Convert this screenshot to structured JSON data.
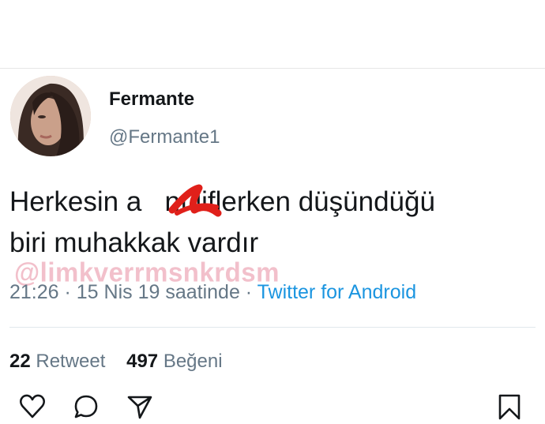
{
  "tweet": {
    "display_name": "Fermante",
    "handle": "@Fermante1",
    "text_line1": "Herkesin a   nı liflerken düşündüğü",
    "text_line2": "biri muhakkak vardır",
    "time": "21:26 · 15 Nis 19 saatinde",
    "separator": " · ",
    "source": "Twitter for Android",
    "watermark": "@limkverrmsnkrdsm"
  },
  "stats": {
    "retweets_count": "22",
    "retweets_label": "Retweet",
    "likes_count": "497",
    "likes_label": "Beğeni"
  },
  "actions": {
    "icons": [
      "heart-icon",
      "comment-icon",
      "share-icon",
      "bookmark-icon"
    ]
  },
  "colors": {
    "text": "#14171a",
    "secondary": "#657786",
    "link": "#1b95e0",
    "redact": "#e0201a",
    "watermark": "#e88ca0"
  }
}
